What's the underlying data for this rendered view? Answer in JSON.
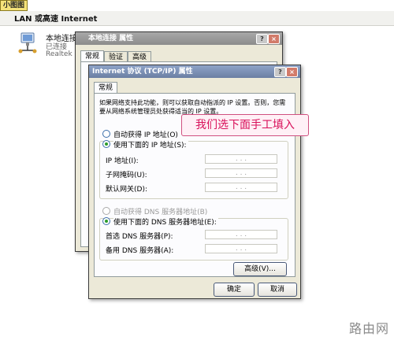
{
  "tag_label": "小图图",
  "header": {
    "title": "LAN 或高速 Internet"
  },
  "connection": {
    "name": "本地连接",
    "status": "已连接",
    "adapter": "Realtek"
  },
  "outer_dialog": {
    "title": "本地连接 属性",
    "tabs": [
      "常规",
      "验证",
      "高级"
    ],
    "help_btn": "?",
    "close_btn": "×"
  },
  "tcpip_dialog": {
    "title": "Internet 协议 (TCP/IP) 属性",
    "help_btn": "?",
    "close_btn": "×",
    "tab": "常规",
    "description": "如果网络支持此功能，则可以获取自动指派的 IP 设置。否则，您需要从网络系统管理员处获得适当的 IP 设置。",
    "ip_auto": "自动获得 IP 地址(O)",
    "ip_manual": "使用下面的 IP 地址(S):",
    "ip_address_label": "IP 地址(I):",
    "subnet_label": "子网掩码(U):",
    "gateway_label": "默认网关(D):",
    "dns_auto": "自动获得 DNS 服务器地址(B)",
    "dns_manual": "使用下面的 DNS 服务器地址(E):",
    "dns_primary_label": "首选 DNS 服务器(P):",
    "dns_alternate_label": "备用 DNS 服务器(A):",
    "advanced_btn": "高级(V)...",
    "ok_btn": "确定",
    "cancel_btn": "取消",
    "ip_placeholder": ".   .   ."
  },
  "callout": "我们选下面手工填入",
  "watermark": "路由网"
}
